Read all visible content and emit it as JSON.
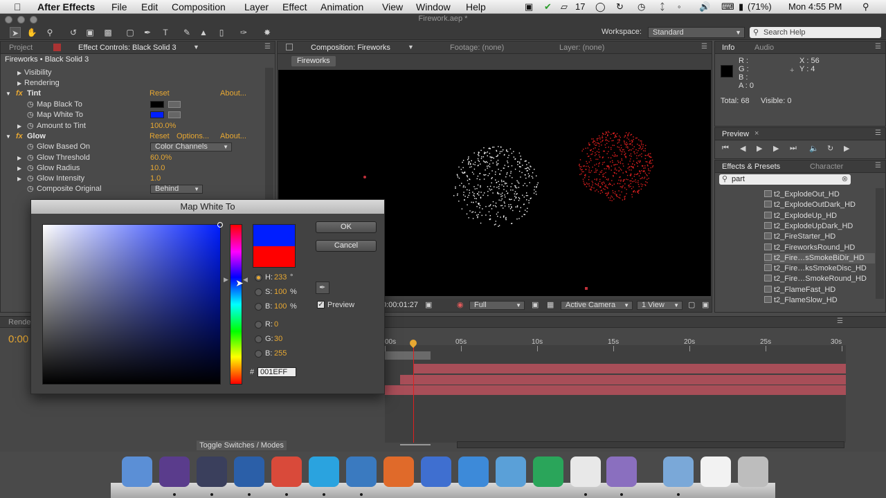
{
  "menubar": {
    "apple_icon": "apple-icon",
    "app_name": "After Effects",
    "menus": [
      "File",
      "Edit",
      "Composition",
      "Layer",
      "Effect",
      "Animation",
      "View",
      "Window",
      "Help"
    ],
    "status_num": "17",
    "battery": "(71%)",
    "clock": "Mon 4:55 PM"
  },
  "window": {
    "title": "Firework.aep *"
  },
  "toolbar": {
    "workspace_label": "Workspace:",
    "workspace_value": "Standard",
    "search_placeholder": "Search Help"
  },
  "left_panel": {
    "tabs": [
      "Project",
      "Effect Controls: Black Solid 3"
    ],
    "header": "Fireworks • Black Solid 3",
    "rows": {
      "visibility": "Visibility",
      "rendering": "Rendering",
      "tint": "Tint",
      "tint_reset": "Reset",
      "tint_about": "About...",
      "map_black": "Map Black To",
      "map_white": "Map White To",
      "amount_to_tint": "Amount to Tint",
      "amount_value": "100.0%",
      "glow": "Glow",
      "glow_reset": "Reset",
      "glow_options": "Options...",
      "glow_about": "About...",
      "glow_based_on": "Glow Based On",
      "glow_based_on_value": "Color Channels",
      "glow_threshold": "Glow Threshold",
      "glow_threshold_value": "60.0%",
      "glow_radius": "Glow Radius",
      "glow_radius_value": "10.0",
      "glow_intensity": "Glow Intensity",
      "glow_intensity_value": "1.0",
      "composite_original": "Composite Original",
      "composite_original_value": "Behind"
    },
    "colors": {
      "map_black": "#000000",
      "map_white": "#001eff"
    }
  },
  "comp_panel": {
    "tabs": [
      "Composition: Fireworks",
      "Footage: (none)",
      "Layer: (none)"
    ],
    "breadcrumb": "Fireworks",
    "timecode": "0:00:01:27",
    "resolution": "Full",
    "camera": "Active Camera",
    "views": "1 View"
  },
  "info_panel": {
    "tabs": [
      "Info",
      "Audio"
    ],
    "r": "R :",
    "g": "G :",
    "b": "B :",
    "a": "A : 0",
    "x": "X : 56",
    "y": "Y : 4",
    "total": "Total: 68",
    "visible": "Visible: 0"
  },
  "preview_panel": {
    "tab": "Preview"
  },
  "effects_panel": {
    "tabs": [
      "Effects & Presets",
      "Character"
    ],
    "search_value": "part",
    "items": [
      "t2_ExplodeOut_HD",
      "t2_ExplodeOutDark_HD",
      "t2_ExplodeUp_HD",
      "t2_ExplodeUpDark_HD",
      "t2_FireStarter_HD",
      "t2_FireworksRound_HD",
      "t2_Fire…sSmokeBiDir_HD",
      "t2_Fire…ksSmokeDisc_HD",
      "t2_Fire…SmokeRound_HD",
      "t2_FlameFast_HD",
      "t2_FlameSlow_HD"
    ],
    "selected_index": 6
  },
  "dialog": {
    "title": "Map White To",
    "ok": "OK",
    "cancel": "Cancel",
    "preview_label": "Preview",
    "h_label": "H:",
    "h_value": "233",
    "h_unit": "°",
    "s_label": "S:",
    "s_value": "100",
    "s_unit": "%",
    "b_label": "B:",
    "b_value": "100",
    "b_unit": "%",
    "r_label": "R:",
    "r_value": "0",
    "g_label": "G:",
    "g_value": "30",
    "bb_label": "B:",
    "bb_value": "255",
    "hash": "#",
    "hex_value": "001EFF",
    "new_color": "#001eff",
    "old_color": "#ff0000"
  },
  "timeline": {
    "tab": "Rende",
    "timecode": "0:00",
    "ruler": [
      "00s",
      "05s",
      "10s",
      "15s",
      "20s",
      "25s",
      "30s"
    ],
    "toggle_label": "Toggle Switches / Modes",
    "bar_color": "#a84e58"
  },
  "dock": {
    "apps": [
      "Finder",
      "DVD Player",
      "Ae",
      "Ps",
      "Chrome",
      "Skype",
      "Photo Booth",
      "Reeder",
      "iTunes",
      "Wunderlist",
      "Preview",
      "uTorrent",
      "TextEdit",
      "Movie",
      "Folder",
      "Documents",
      "Trash"
    ]
  }
}
